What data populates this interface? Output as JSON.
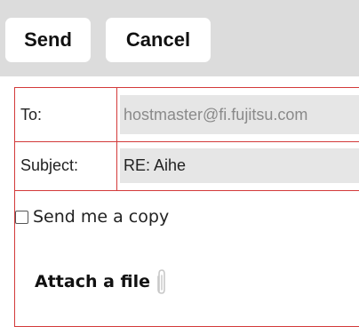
{
  "toolbar": {
    "send_label": "Send",
    "cancel_label": "Cancel"
  },
  "form": {
    "to_label": "To:",
    "to_value": "hostmaster@fi.fujitsu.com",
    "subject_label": "Subject:",
    "subject_value": "RE: Aihe",
    "copy_label": "Send me a copy",
    "copy_checked": false,
    "attach_label": "Attach a file",
    "attach_icon": "paperclip-icon"
  },
  "colors": {
    "toolbar_bg": "#dcdcdc",
    "border_accent": "#d33a3a",
    "field_bg": "#e6e6e6"
  }
}
